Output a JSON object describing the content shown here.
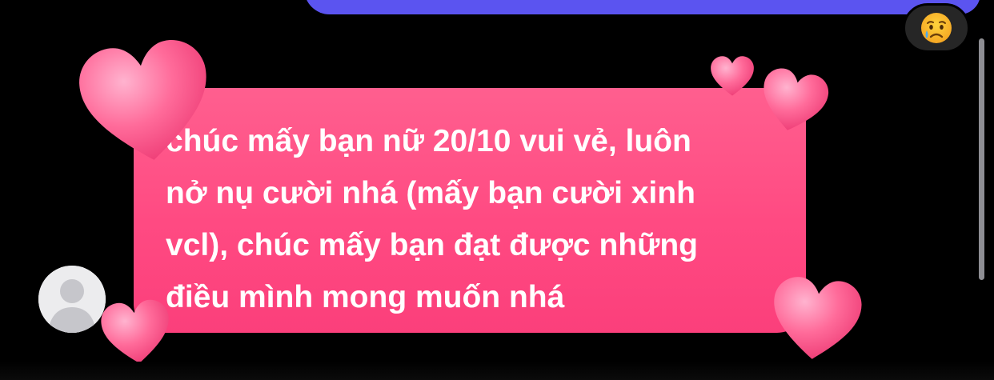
{
  "colors": {
    "background": "#000000",
    "sent_bubble": "#5b54f0",
    "received_bubble": "#ff4a82",
    "heart": "#ff5c8e",
    "reaction_chip": "#262626"
  },
  "reaction": {
    "icon": "crying-face-emoji"
  },
  "message": {
    "text": "chúc mấy bạn nữ 20/10 vui vẻ, luôn\nnở nụ cười nhá (mấy bạn cười xinh\nvcl), chúc mấy bạn đạt được những\nđiều mình mong muốn nhá",
    "effect": "hearts"
  },
  "sender": {
    "avatar": "default-avatar"
  }
}
